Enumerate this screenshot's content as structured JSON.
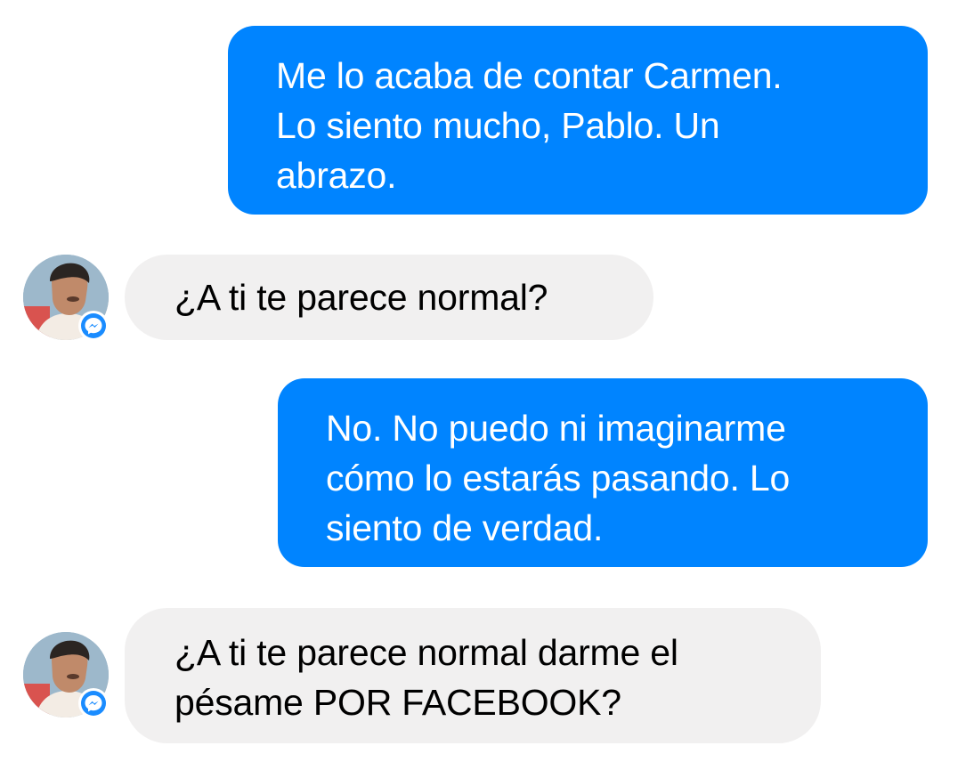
{
  "conversation": {
    "messages": [
      {
        "sender": "me",
        "text": "Me lo acaba de contar Carmen.\nLo siento mucho, Pablo. Un\nabrazo."
      },
      {
        "sender": "contact",
        "text": "¿A ti te parece normal?"
      },
      {
        "sender": "me",
        "text": "No. No puedo ni imaginarme\ncómo lo estarás pasando. Lo\nsiento de verdad."
      },
      {
        "sender": "contact",
        "text": "¿A ti te parece normal darme el\npésame POR FACEBOOK?"
      }
    ]
  },
  "icons": {
    "avatar": "contact-avatar-photo",
    "badge": "messenger-badge-icon"
  },
  "colors": {
    "outgoing_bubble": "#0084ff",
    "incoming_bubble": "#f1f0f0",
    "messenger_badge": "#1a8cff"
  }
}
